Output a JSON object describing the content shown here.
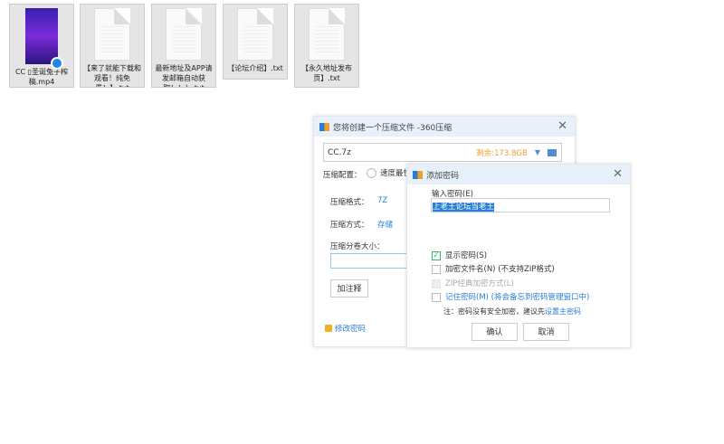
{
  "files": [
    {
      "name": "CC ▯圣诞兔子榨稿.mp4",
      "type": "video"
    },
    {
      "name": "【来了就能下载和观看！纯免费！】.txt",
      "type": "txt"
    },
    {
      "name": "最新地址及APP请发邮箱自动获取！！！.txt",
      "type": "txt"
    },
    {
      "name": "【论坛介绍】.txt",
      "type": "txt"
    },
    {
      "name": "【永久地址发布页】.txt",
      "type": "txt"
    }
  ],
  "main_dialog": {
    "title": "您将创建一个压缩文件 -360压缩",
    "filename": "CC.7z",
    "free_space": "剩余:173.8GB",
    "config_label": "压缩配置：",
    "config_option": "速度最快",
    "format_label": "压缩格式：",
    "format_value": "7Z",
    "method_label": "压缩方式：",
    "method_value": "存储",
    "split_label": "压缩分卷大小：",
    "split_value": "",
    "comment_button": "加注释",
    "change_password": "修改密码"
  },
  "password_dialog": {
    "title": "添加密码",
    "input_label": "输入密码(E)",
    "password": "上老王论坛当老王",
    "show_password": "显示密码(S)",
    "encrypt_names": "加密文件名(N) (不支持ZIP格式)",
    "zip_classic": "ZIP经典加密方式(L)",
    "remember": "记住密码(M) (将会备忘到密码管理窗口中)",
    "note": "注：密码没有安全加密，建议先",
    "note_link": "设置主密码",
    "ok": "确认",
    "cancel": "取消"
  }
}
